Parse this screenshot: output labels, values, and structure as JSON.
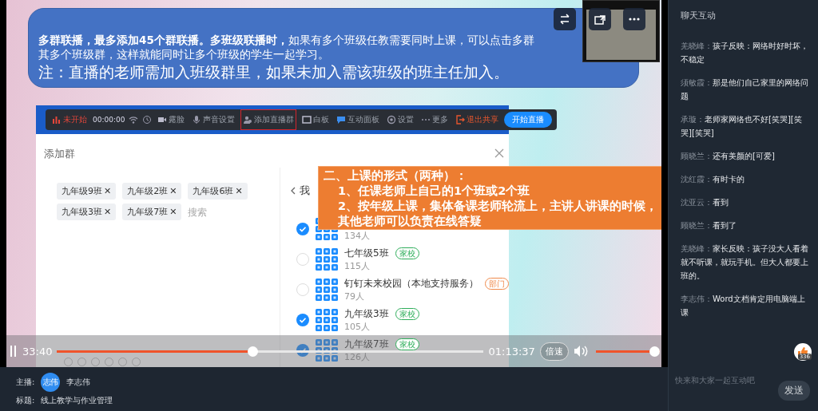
{
  "slide": {
    "callout": {
      "lines": [
        "**多群联播，最多添加45个群联播。多班级联播时，**如果有多个班级任教需要同时上课，可以点击多群",
        "其多个班级群，这样就能同时让多个班级的学生一起学习。"
      ],
      "note": "注：直播的老师需加入班级群里，如果未加入需该班级的班主任加入。"
    },
    "toolbar": [
      {
        "label": "未开始",
        "kind": "status",
        "highlighted": false
      },
      {
        "label": "00:00:00",
        "kind": "timer",
        "highlighted": false
      },
      {
        "label": "露脸",
        "kind": "tool",
        "highlighted": false
      },
      {
        "label": "声音设置",
        "kind": "tool",
        "highlighted": false
      },
      {
        "label": "添加直播群",
        "kind": "tool",
        "highlighted": true
      },
      {
        "label": "白板",
        "kind": "tool",
        "highlighted": false
      },
      {
        "label": "互动面板",
        "kind": "tool",
        "highlighted": false
      },
      {
        "label": "设置",
        "kind": "tool",
        "highlighted": false
      },
      {
        "label": "更多",
        "kind": "tool",
        "highlighted": false
      },
      {
        "label": "退出共享",
        "kind": "exit",
        "highlighted": false
      },
      {
        "label": "开始直播",
        "kind": "primary",
        "highlighted": false
      }
    ],
    "dialog": {
      "title": "添加群",
      "chips": [
        "九年级9班",
        "九年级2班",
        "九年级6班",
        "九年级3班",
        "九年级7班"
      ],
      "chip_remove": "✕",
      "search": {
        "placeholder": "搜索"
      },
      "back_label": "我",
      "groups": [
        {
          "count": "134人",
          "checked": true
        },
        {
          "name": "七年级5班",
          "tag": "家校",
          "color": "#2fae5b",
          "count": "115人",
          "checked": false
        },
        {
          "name": "钉钉未来校园（本地支持服务）",
          "tag": "部门",
          "color": "#f08a4b",
          "count": "79人",
          "checked": false
        },
        {
          "name": "九年级3班",
          "tag": "家校",
          "color": "#2fae5b",
          "count": "105人",
          "checked": true
        },
        {
          "name": "九年级7班",
          "tag": "家校",
          "color": "#2fae5b",
          "count": "126人",
          "checked": true
        }
      ]
    },
    "note_box": {
      "title": "二、上课的形式（两种）：",
      "lines": [
        "1、任课老师上自己的1个班或2个班",
        "2、按年级上课，集体备课老师轮流上，主讲人讲课的时候，其他老师可以负责在线答疑"
      ]
    }
  },
  "player": {
    "elapsed": "33:40",
    "progress": {
      "level": 0.457
    },
    "duration": "01:13:37",
    "speed": "倍速",
    "volume": {
      "level": 1
    }
  },
  "chat": {
    "title": "聊天互动",
    "messages": [
      {
        "author": "羌晓峰：",
        "text": "孩子反映：网络时好时坏，不稳定"
      },
      {
        "author": "须敏霞：",
        "text": "那是他们自己家里的网络问题"
      },
      {
        "author": "承璇：",
        "text": "老师家网络也不好[笑哭][笑哭][笑哭]"
      },
      {
        "author": "顾晓兰：",
        "text": "还有美颜的[可爱]"
      },
      {
        "author": "沈红霞：",
        "text": "有时卡的"
      },
      {
        "author": "沈亚云：",
        "text": "看到"
      },
      {
        "author": "顾晓兰：",
        "text": "看到了"
      },
      {
        "author": "羌晓峰：",
        "text": "家长反映：孩子没大人看着就不听课，就玩手机。但大人都要上班的。"
      },
      {
        "author": "李志伟：",
        "text": "Word文档肯定用电脑端上课"
      }
    ],
    "like_count": "336",
    "input": {
      "placeholder": "快来和大家一起互动吧"
    },
    "send": "发送"
  },
  "footer": {
    "host_label": "主播:",
    "host_avatar": "志伟",
    "host": "李志伟",
    "title_label": "标题:",
    "title": "线上教学与作业管理"
  }
}
